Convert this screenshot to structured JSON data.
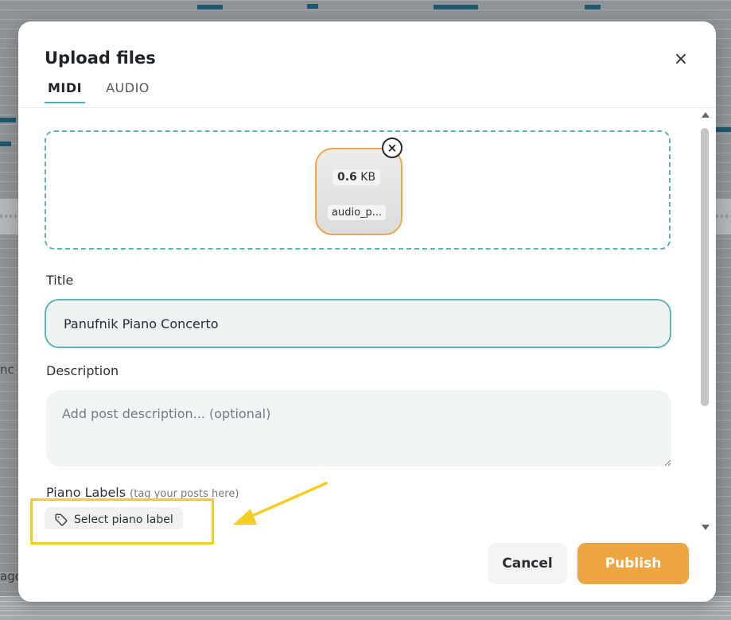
{
  "background": {
    "partial_text_1": "nc",
    "partial_text_2": "ago"
  },
  "dialog": {
    "title": "Upload files",
    "close_label": "×",
    "tabs": [
      {
        "label": "MIDI",
        "active": true
      },
      {
        "label": "AUDIO",
        "active": false
      }
    ]
  },
  "file": {
    "size_value": "0.6",
    "size_unit": "KB",
    "name": "audio_p...",
    "remove_label": "×"
  },
  "form": {
    "title_label": "Title",
    "title_value": "Panufnik Piano Concerto",
    "description_label": "Description",
    "description_placeholder": "Add post description... (optional)",
    "piano_labels_label": "Piano Labels",
    "piano_labels_hint": "(tag your posts here)",
    "select_label_button": "Select piano label"
  },
  "actions": {
    "cancel_label": "Cancel",
    "publish_label": "Publish"
  },
  "colors": {
    "accent_teal": "#57b3bc",
    "accent_orange": "#eca541",
    "annotation_yellow": "#f5cc21"
  }
}
